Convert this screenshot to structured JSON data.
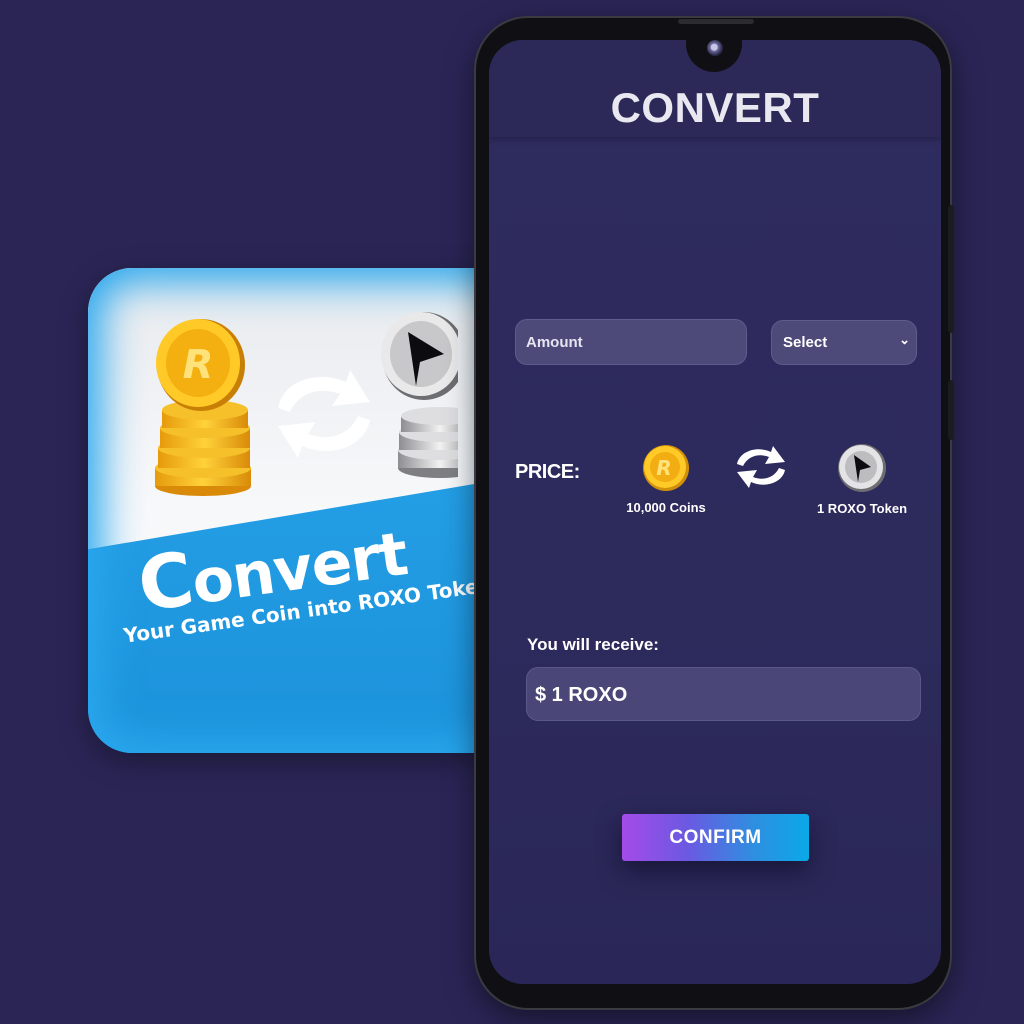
{
  "promo": {
    "title_initial": "C",
    "title_rest": "onvert",
    "subtitle": "Your Game Coin into ROXO Token",
    "icons": [
      "gold-coin-stack-icon",
      "swap-arrows-icon",
      "silver-token-stack-icon"
    ]
  },
  "screen": {
    "title": "CONVERT",
    "amount_placeholder": "Amount",
    "select_value": "Select",
    "price": {
      "label": "PRICE:",
      "from_caption": "10,000 Coins",
      "to_caption": "1 ROXO Token"
    },
    "receive": {
      "label": "You will receive:",
      "value": "$ 1 ROXO"
    },
    "confirm_label": "CONFIRM"
  },
  "colors": {
    "background": "#2a2555",
    "screen": "#2e2b5f",
    "promo_blue": "#1d97dd",
    "gold": "#f3b51a",
    "confirm_start": "#a44be8",
    "confirm_end": "#0aa9e8"
  }
}
